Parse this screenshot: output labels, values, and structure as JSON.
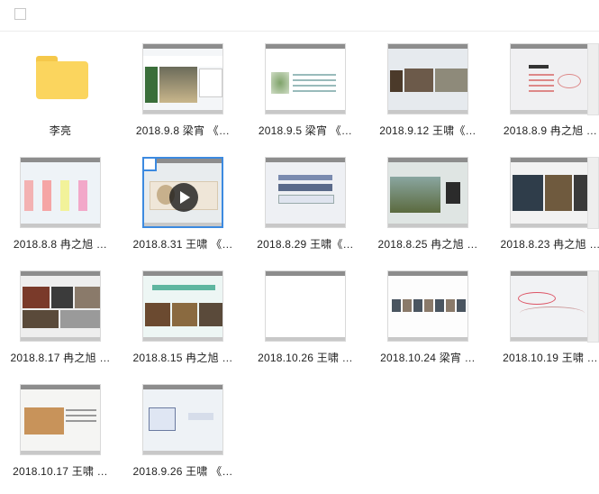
{
  "toolbar": {
    "select_all_checked": false
  },
  "items": [
    {
      "type": "folder",
      "label": "李亮"
    },
    {
      "type": "video",
      "label": "2018.9.8 梁宵 《…",
      "theme": "interior"
    },
    {
      "type": "video",
      "label": "2018.9.5 梁宵 《…",
      "theme": "list"
    },
    {
      "type": "video",
      "label": "2018.9.12 王啸《…",
      "theme": "painting"
    },
    {
      "type": "video",
      "label": "2018.8.9 冉之旭 …",
      "theme": "mindmap"
    },
    {
      "type": "video",
      "label": "2018.8.8 冉之旭 …",
      "theme": "columns"
    },
    {
      "type": "video",
      "label": "2018.8.31 王啸 《…",
      "theme": "title",
      "selected": true
    },
    {
      "type": "video",
      "label": "2018.8.29 王啸《…",
      "theme": "table"
    },
    {
      "type": "video",
      "label": "2018.8.25 冉之旭 …",
      "theme": "building"
    },
    {
      "type": "video",
      "label": "2018.8.23 冉之旭 …",
      "theme": "portrait"
    },
    {
      "type": "video",
      "label": "2018.8.17 冉之旭 …",
      "theme": "collage"
    },
    {
      "type": "video",
      "label": "2018.8.15 冉之旭 …",
      "theme": "rooms"
    },
    {
      "type": "video",
      "label": "2018.10.26 王啸 …",
      "theme": "blank"
    },
    {
      "type": "video",
      "label": "2018.10.24 梁宵 …",
      "theme": "strip"
    },
    {
      "type": "video",
      "label": "2018.10.19 王啸 …",
      "theme": "sketch"
    },
    {
      "type": "video",
      "label": "2018.10.17 王啸 …",
      "theme": "model"
    },
    {
      "type": "video",
      "label": "2018.9.26 王啸 《…",
      "theme": "diagram"
    }
  ]
}
